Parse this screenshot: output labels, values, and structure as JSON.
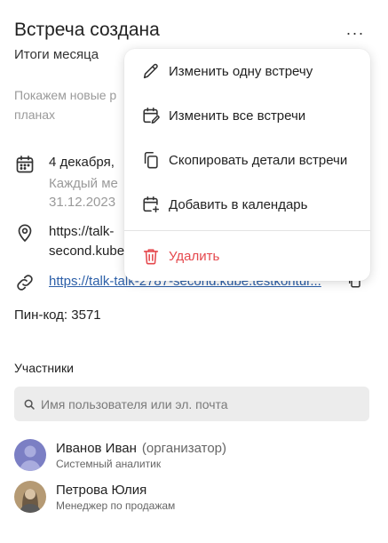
{
  "header": {
    "title": "Встреча создана",
    "more_label": "···",
    "subtitle": "Итоги месяца"
  },
  "description": {
    "line1": "Покажем новые р",
    "line2": "планах"
  },
  "schedule": {
    "date": "4 декабря, ",
    "repeat_line1": "Каждый ме",
    "repeat_line2": "31.12.2023"
  },
  "location": {
    "line1": "https://talk-",
    "line2": "second.kube"
  },
  "meeting_link": {
    "url": "https://talk-talk-2787-second.kube.testkontur..."
  },
  "pin": "Пин-код: 3571",
  "participants_section": {
    "heading": "Участники",
    "search_placeholder": "Имя пользователя или эл. почта"
  },
  "participants": [
    {
      "name": "Иванов Иван",
      "tag": "(организатор)",
      "position": "Системный аналитик",
      "avatar_color": "#7b7fc4"
    },
    {
      "name": "Петрова Юлия",
      "tag": "",
      "position": "Менеджер по продажам",
      "avatar_color": "#b59a74"
    }
  ],
  "menu": {
    "items": [
      {
        "label": "Изменить одну встречу",
        "icon": "pencil-icon"
      },
      {
        "label": "Изменить все встречи",
        "icon": "calendar-edit-icon"
      },
      {
        "label": "Скопировать детали встречи",
        "icon": "copy-icon"
      },
      {
        "label": "Добавить в календарь",
        "icon": "calendar-add-icon"
      }
    ],
    "delete": {
      "label": "Удалить",
      "icon": "trash-icon"
    }
  },
  "colors": {
    "link": "#2c5fa8",
    "danger": "#e5484d",
    "muted_text": "#9a9a9a",
    "search_bg": "#ececec"
  }
}
